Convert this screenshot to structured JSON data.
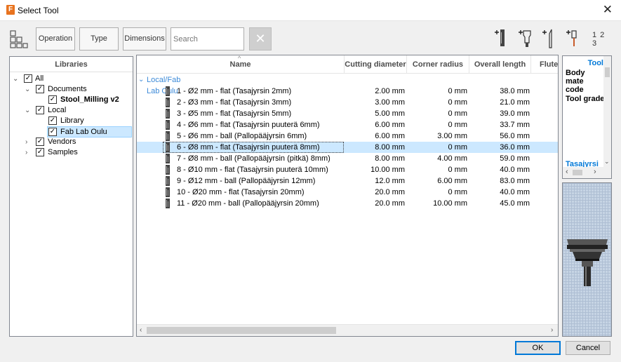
{
  "window": {
    "title": "Select Tool",
    "app_icon_letter": "F"
  },
  "toolbar": {
    "operation_label": "Operation",
    "type_label": "Type",
    "dimensions_label": "Dimensions",
    "search_placeholder": "Search",
    "clear_label": "✕",
    "numbering_label": "1 2 3"
  },
  "libraries": {
    "header": "Libraries",
    "items": [
      {
        "label": "All"
      },
      {
        "label": "Documents"
      },
      {
        "label": "Stool_Milling v2"
      },
      {
        "label": "Local"
      },
      {
        "label": "Library"
      },
      {
        "label": "Fab Lab Oulu"
      },
      {
        "label": "Vendors"
      },
      {
        "label": "Samples"
      }
    ]
  },
  "grid": {
    "columns": [
      "Name",
      "Cutting diameter",
      "Corner radius",
      "Overall length",
      "Flute"
    ],
    "group": "Local/Fab Lab Oulu",
    "rows": [
      {
        "name": "1 - Ø2 mm - flat (Tasajyrsin 2mm)",
        "diameter": "2.00 mm",
        "radius": "0 mm",
        "length": "38.0 mm"
      },
      {
        "name": "2 - Ø3 mm - flat (Tasajyrsin 3mm)",
        "diameter": "3.00 mm",
        "radius": "0 mm",
        "length": "21.0 mm"
      },
      {
        "name": "3 - Ø5 mm - flat (Tasajyrsin 5mm)",
        "diameter": "5.00 mm",
        "radius": "0 mm",
        "length": "39.0 mm"
      },
      {
        "name": "4 - Ø6 mm - flat (Tasajyrsin puuterä 6mm)",
        "diameter": "6.00 mm",
        "radius": "0 mm",
        "length": "33.7 mm"
      },
      {
        "name": "5 - Ø6 mm - ball (Pallopääjyrsin 6mm)",
        "diameter": "6.00 mm",
        "radius": "3.00 mm",
        "length": "56.0 mm"
      },
      {
        "name": "6 - Ø8 mm - flat (Tasajyrsin puuterä 8mm)",
        "diameter": "8.00 mm",
        "radius": "0 mm",
        "length": "36.0 mm"
      },
      {
        "name": "7 - Ø8 mm - ball (Pallopääjyrsin (pitkä) 8mm)",
        "diameter": "8.00 mm",
        "radius": "4.00 mm",
        "length": "59.0 mm"
      },
      {
        "name": "8 - Ø10 mm - flat (Tasajyrsin puuterä 10mm)",
        "diameter": "10.00 mm",
        "radius": "0 mm",
        "length": "40.0 mm"
      },
      {
        "name": "9 - Ø12 mm - ball (Pallopääjyrsin 12mm)",
        "diameter": "12.0 mm",
        "radius": "6.00 mm",
        "length": "83.0 mm"
      },
      {
        "name": "10 - Ø20 mm - flat (Tasajyrsin 20mm)",
        "diameter": "20.0 mm",
        "radius": "0 mm",
        "length": "40.0 mm"
      },
      {
        "name": "11 - Ø20 mm - ball (Pallopääjyrsin 20mm)",
        "diameter": "20.0 mm",
        "radius": "10.00 mm",
        "length": "45.0 mm"
      }
    ]
  },
  "info_panel": {
    "heading": "Tool",
    "body_material_label": "Body mate code",
    "tool_grade_label": "Tool grade",
    "footer_link": "Tasajyrsi"
  },
  "buttons": {
    "ok": "OK",
    "cancel": "Cancel"
  },
  "colors": {
    "accent": "#0078d7",
    "group_text": "#3c8ad8",
    "selection": "#cce8ff"
  }
}
